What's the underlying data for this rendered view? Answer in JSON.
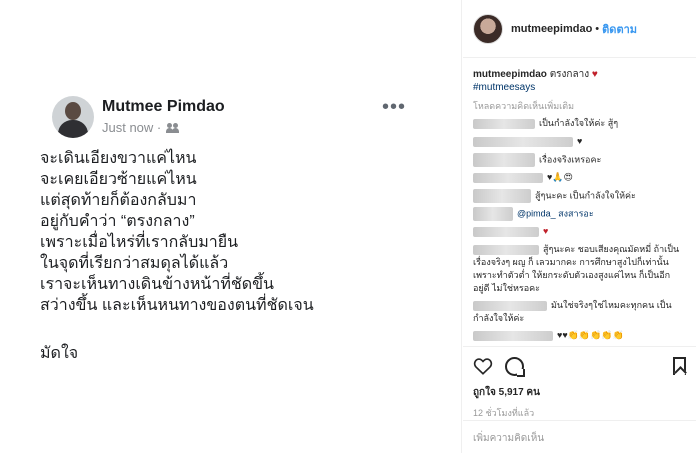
{
  "post": {
    "author": "Mutmee Pimdao",
    "time": "Just now ·",
    "lines": [
      "จะเดินเอียงขวาแค่ไหน",
      "จะเคยเอียวซ้ายแค่ไหน",
      "แต่สุดท้ายก็ต้องกลับมา",
      "อยู่กับคำว่า “ตรงกลาง”",
      "เพราะเมื่อไหร่ที่เรากลับมายืน",
      "ในจุดที่เรียกว่าสมดุลได้แล้ว",
      "เราจะเห็นทางเดินข้างหน้าที่ชัดขึ้น",
      "สว่างขึ้น และเห็นหนทางของตนที่ชัดเจน"
    ],
    "signoff": "มัดใจ",
    "more": "•••"
  },
  "header": {
    "username": "mutmeepimdao",
    "dot": "•",
    "follow": "ติดตาม"
  },
  "caption": {
    "username": "mutmeepimdao",
    "text": "ตรงกลาง",
    "heart": "♥",
    "hashtag": "#mutmeesays"
  },
  "load_more": "โหลดความคิดเห็นเพิ่มเติม",
  "comments": [
    {
      "text": "เป็นกำลังใจให้ค่ะ สู้ๆ"
    },
    {
      "text": "♥"
    },
    {
      "text": "เรื่องจริงเหรอคะ"
    },
    {
      "text": "♥🙏😍"
    },
    {
      "text": "สู้ๆนะคะ เป็นกำลังใจให้ค่ะ"
    },
    {
      "text": "@pimda_ สงสารอะ",
      "tag": "@pimda_"
    },
    {
      "text": "♥"
    },
    {
      "text": "สู้ๆนะคะ ชอบเสียงคุณมัดหมี่ ถ้าเป็นเรื่องจริงๆ ผญ ก็ เลวมากคะ การศึกษาสูงไปก็เท่านั้น เพราะทำตัวต่ำ ให้ยกระดับตัวเองสูงแค่ไหน ก็เป็นอีกอยู่ดี ไม่ใช่หรอคะ"
    },
    {
      "text": "มันใช่จริงๆใช่ไหมคะทุกคน เป็นกำลังใจให้ค่ะ"
    },
    {
      "text": "♥♥👏👏👏👏👏"
    }
  ],
  "likes": "ถูกใจ 5,917 คน",
  "time_ago": "12 ชั่วโมงที่แล้ว",
  "add_comment_placeholder": "เพิ่มความคิดเห็น",
  "colors": {
    "link": "#3897f0",
    "heart": "#c0202a",
    "hashtag": "#003569"
  }
}
